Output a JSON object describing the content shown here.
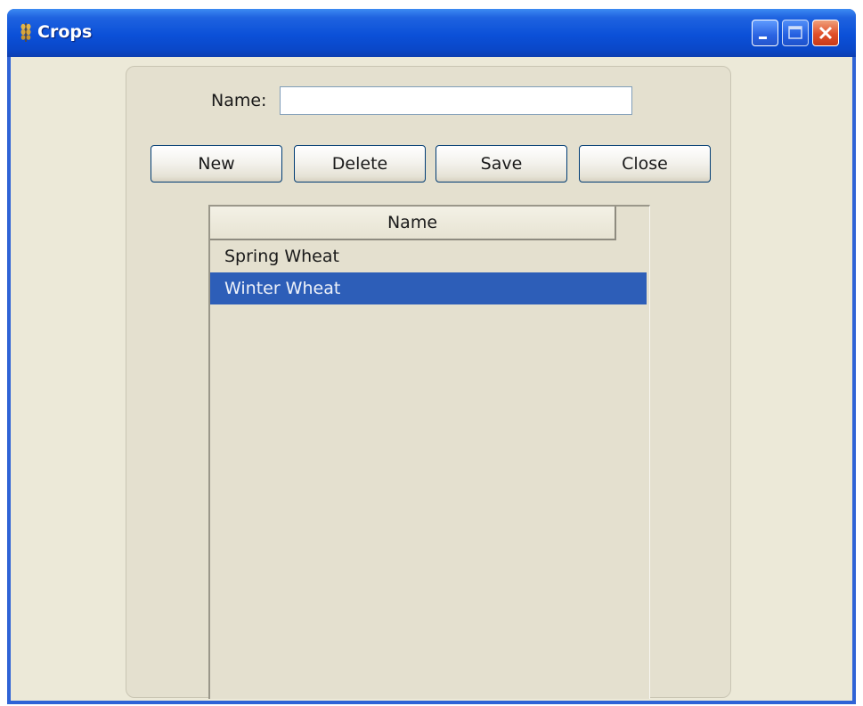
{
  "window": {
    "title": "Crops",
    "controls": {
      "minimize_icon": "minimize-icon",
      "maximize_icon": "maximize-icon",
      "close_icon": "close-icon"
    },
    "accent_color": "#0b50d8",
    "close_color": "#e0502a"
  },
  "form": {
    "name_label": "Name:",
    "name_value": ""
  },
  "toolbar": {
    "new_label": "New",
    "delete_label": "Delete",
    "save_label": "Save",
    "close_label": "Close"
  },
  "table": {
    "columns": [
      "Name"
    ],
    "rows": [
      {
        "name": "Spring Wheat",
        "selected": false
      },
      {
        "name": "Winter Wheat",
        "selected": true
      }
    ],
    "selection_color": "#2d5eb8"
  }
}
